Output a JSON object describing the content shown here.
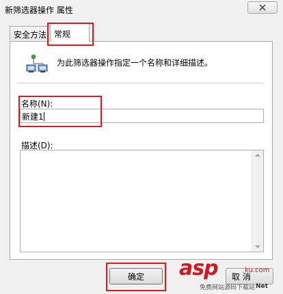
{
  "window": {
    "title": "新筛选器操作 属性",
    "close_glyph": "✕"
  },
  "tabs": [
    {
      "label": "安全方法",
      "active": false
    },
    {
      "label": "常规",
      "active": true
    }
  ],
  "general": {
    "description": "为此筛选器操作指定一个名称和详细描述。",
    "icon": "network-computers-icon",
    "name_label": "名称(N):",
    "name_value": "新建1",
    "desc_label": "描述(D):",
    "desc_value": ""
  },
  "buttons": {
    "ok": "确定",
    "partial": "取 消"
  },
  "annotations": {
    "highlight_color": "#e0161f"
  },
  "watermark": {
    "logo": "asp",
    "domain": "ku.com",
    "subtitle": "免费网站源码下载站",
    "net": "Net"
  }
}
